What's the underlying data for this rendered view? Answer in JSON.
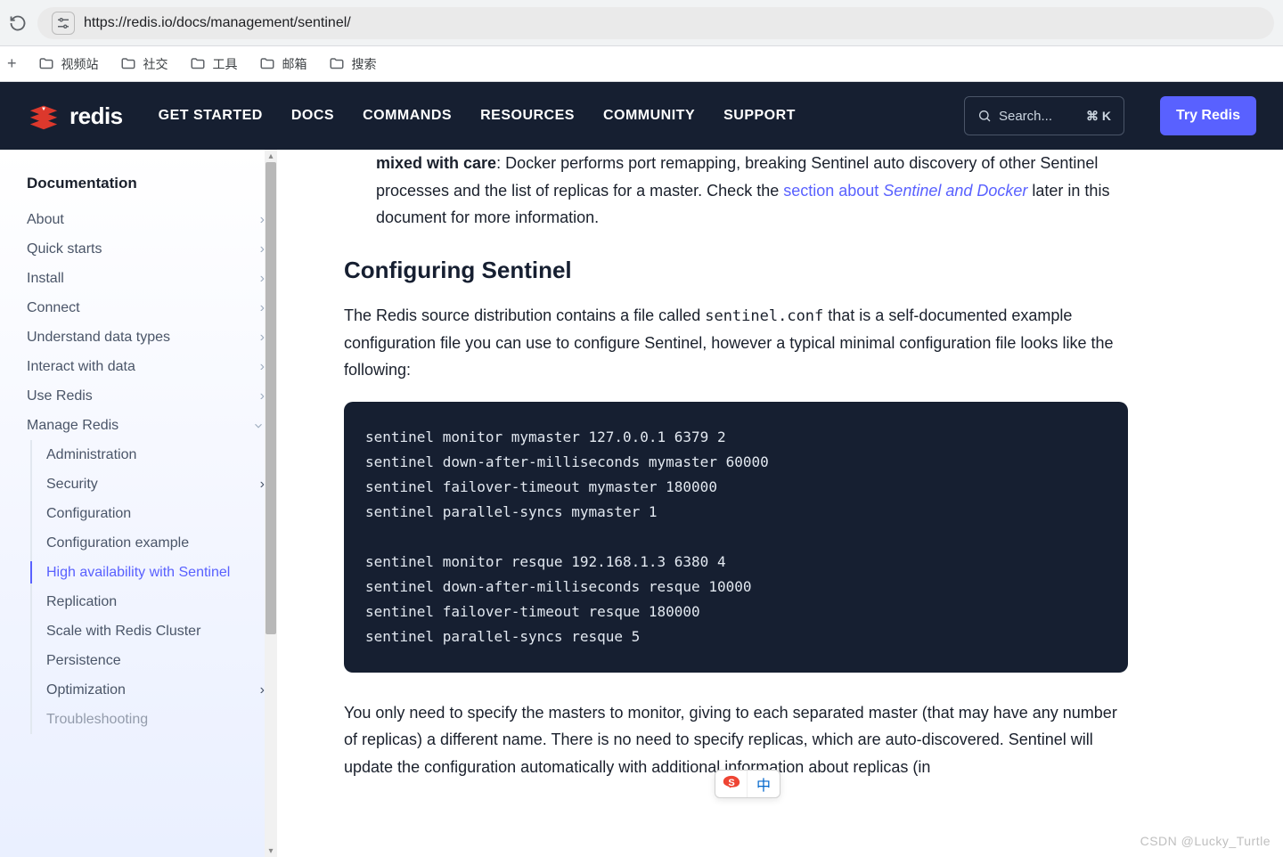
{
  "browser": {
    "url": "https://redis.io/docs/management/sentinel/"
  },
  "bookmarks": [
    {
      "label": "视频站"
    },
    {
      "label": "社交"
    },
    {
      "label": "工具"
    },
    {
      "label": "邮箱"
    },
    {
      "label": "搜索"
    }
  ],
  "header": {
    "logo_text": "redis",
    "nav": [
      "GET STARTED",
      "DOCS",
      "COMMANDS",
      "RESOURCES",
      "COMMUNITY",
      "SUPPORT"
    ],
    "search_placeholder": "Search...",
    "search_shortcut": "⌘ K",
    "try_label": "Try Redis"
  },
  "sidebar": {
    "heading": "Documentation",
    "items": [
      {
        "label": "About",
        "expandable": true
      },
      {
        "label": "Quick starts",
        "expandable": true
      },
      {
        "label": "Install",
        "expandable": true
      },
      {
        "label": "Connect",
        "expandable": true
      },
      {
        "label": "Understand data types",
        "expandable": true
      },
      {
        "label": "Interact with data",
        "expandable": true
      },
      {
        "label": "Use Redis",
        "expandable": true
      },
      {
        "label": "Manage Redis",
        "expandable": true,
        "open": true
      }
    ],
    "sub": [
      {
        "label": "Administration"
      },
      {
        "label": "Security",
        "expandable": true
      },
      {
        "label": "Configuration"
      },
      {
        "label": "Configuration example"
      },
      {
        "label": "High availability with Sentinel",
        "active": true
      },
      {
        "label": "Replication"
      },
      {
        "label": "Scale with Redis Cluster"
      },
      {
        "label": "Persistence"
      },
      {
        "label": "Optimization",
        "expandable": true
      },
      {
        "label": "Troubleshooting"
      }
    ]
  },
  "content": {
    "frag_bold": "mixed with care",
    "frag_text1": ": Docker performs port remapping, breaking Sentinel auto discovery of other Sentinel processes and the list of replicas for a master. Check the ",
    "frag_link1": "section about ",
    "frag_link_italic": "Sentinel and Docker",
    "frag_text2": " later in this document for more information.",
    "h2": "Configuring Sentinel",
    "p1a": "The Redis source distribution contains a file called ",
    "p1code": "sentinel.conf",
    "p1b": " that is a self-documented example configuration file you can use to configure Sentinel, however a typical minimal configuration file looks like the following:",
    "code": "sentinel monitor mymaster 127.0.0.1 6379 2\nsentinel down-after-milliseconds mymaster 60000\nsentinel failover-timeout mymaster 180000\nsentinel parallel-syncs mymaster 1\n\nsentinel monitor resque 192.168.1.3 6380 4\nsentinel down-after-milliseconds resque 10000\nsentinel failover-timeout resque 180000\nsentinel parallel-syncs resque 5",
    "p2": "You only need to specify the masters to monitor, giving to each separated master (that may have any number of replicas) a different name. There is no need to specify replicas, which are auto-discovered. Sentinel will update the configuration automatically with additional information about replicas (in"
  },
  "ime": {
    "logo_char": "S",
    "lang_char": "中"
  },
  "watermark": "CSDN @Lucky_Turtle"
}
